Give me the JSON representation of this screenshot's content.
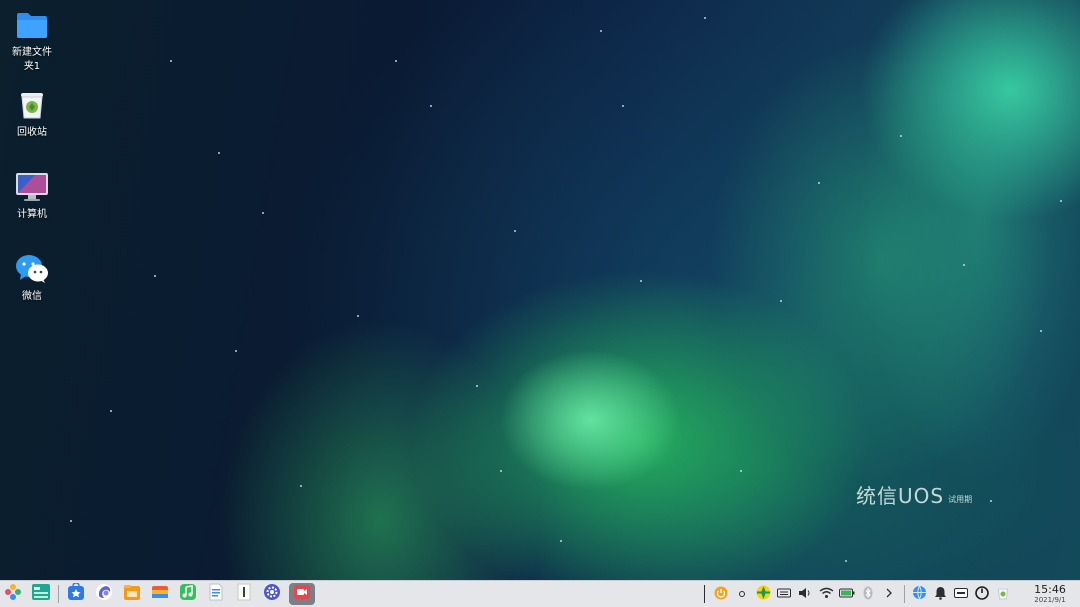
{
  "desktop": {
    "icons": [
      {
        "label": "新建文件夹1",
        "icon": "folder-icon"
      },
      {
        "label": "回收站",
        "icon": "trash-icon"
      },
      {
        "label": "计算机",
        "icon": "computer-icon"
      },
      {
        "label": "微信",
        "icon": "wechat-icon"
      }
    ],
    "brand": {
      "name": "统信UOS",
      "tag": "试用期"
    }
  },
  "taskbar": {
    "apps": [
      {
        "name": "launcher",
        "icon": "launcher-icon"
      },
      {
        "name": "multitask-view",
        "icon": "multitask-view-icon"
      },
      {
        "name": "app-store",
        "icon": "app-store-icon"
      },
      {
        "name": "browser",
        "icon": "browser-icon"
      },
      {
        "name": "file-manager",
        "icon": "file-manager-icon"
      },
      {
        "name": "photos",
        "icon": "photos-icon"
      },
      {
        "name": "music",
        "icon": "music-icon"
      },
      {
        "name": "document-viewer",
        "icon": "document-viewer-icon"
      },
      {
        "name": "text-editor",
        "icon": "text-editor-icon"
      },
      {
        "name": "control-center",
        "icon": "control-center-icon"
      },
      {
        "name": "screen-recorder",
        "icon": "screen-recorder-icon",
        "active": true
      }
    ],
    "tray": [
      "power-app-icon",
      "dot-icon",
      "vpn-icon",
      "keyboard-icon",
      "volume-icon",
      "wifi-icon",
      "battery-icon",
      "bluetooth-icon",
      "expand-arrow-icon",
      "network-globe-icon",
      "notification-bell-icon",
      "input-method-icon",
      "shutdown-icon",
      "trash-tray-icon"
    ],
    "clock": {
      "time": "15:46",
      "date": "2021/9/1"
    }
  },
  "colors": {
    "taskbar_bg": "#e4e6ea",
    "active_app_bg": "#7c7f86"
  }
}
